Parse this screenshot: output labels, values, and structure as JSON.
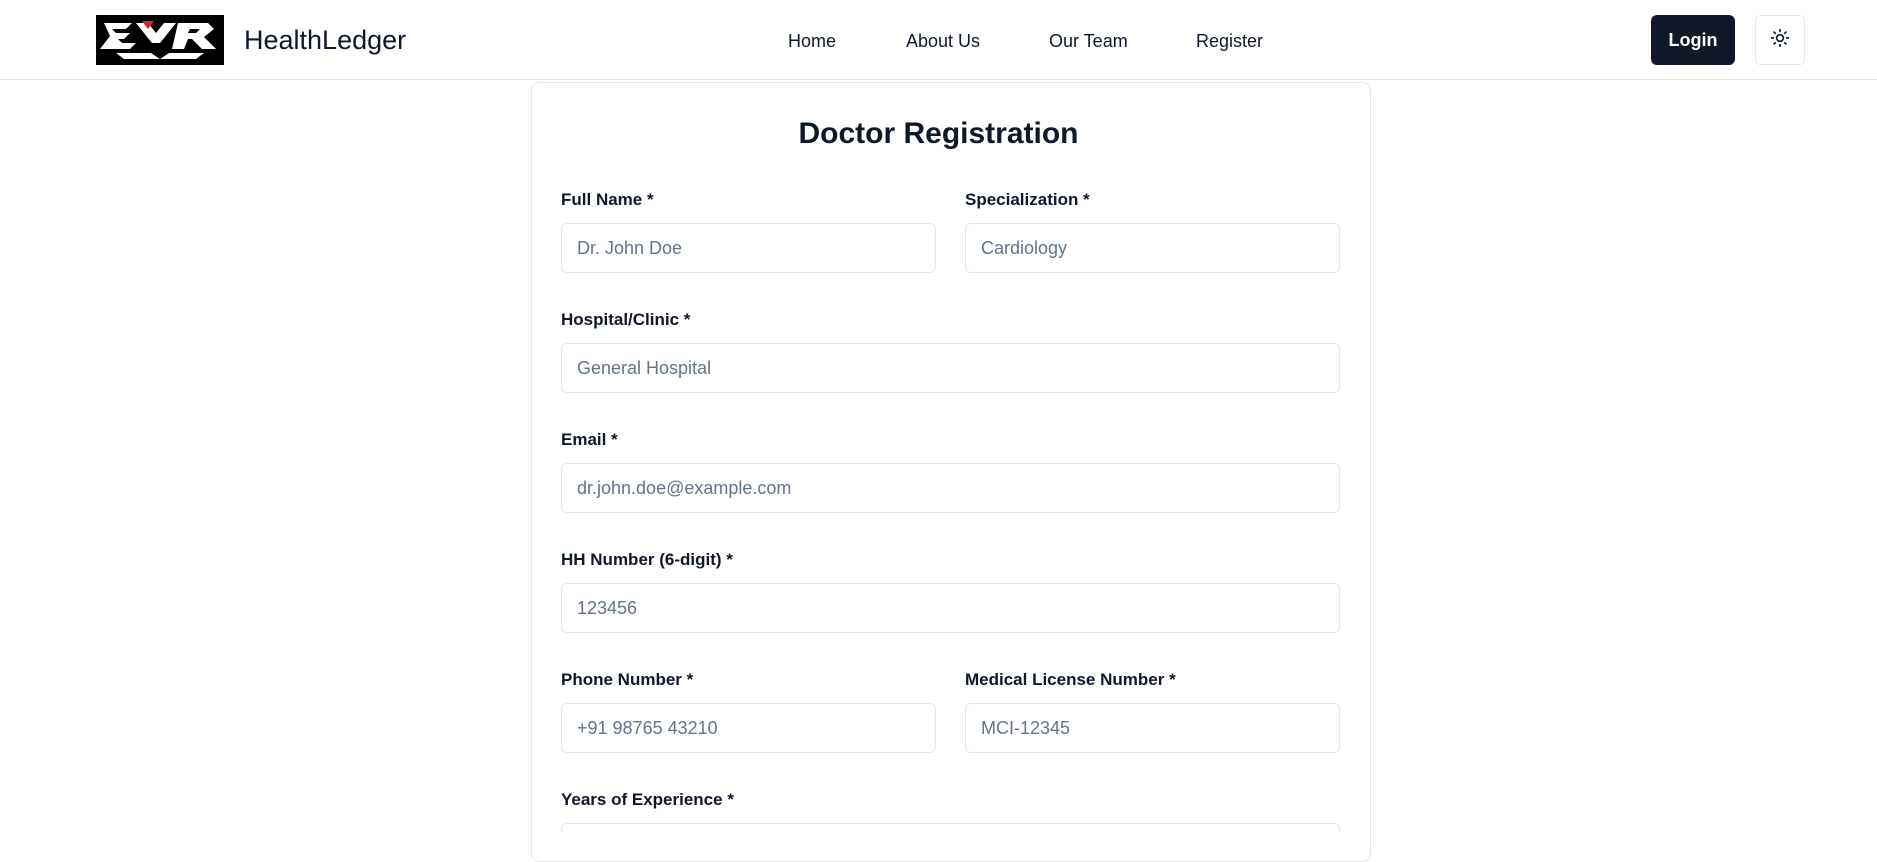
{
  "header": {
    "brand": "HealthLedger",
    "logo_icon": "ehr-logo",
    "nav": {
      "home": "Home",
      "about": "About Us",
      "team": "Our Team",
      "register": "Register"
    },
    "login_label": "Login",
    "theme_icon": "sun-icon"
  },
  "form": {
    "title": "Doctor Registration",
    "fields": {
      "full_name": {
        "label": "Full Name *",
        "placeholder": "Dr. John Doe"
      },
      "specialization": {
        "label": "Specialization *",
        "placeholder": "Cardiology"
      },
      "hospital": {
        "label": "Hospital/Clinic *",
        "placeholder": "General Hospital"
      },
      "email": {
        "label": "Email *",
        "placeholder": "dr.john.doe@example.com"
      },
      "hh_number": {
        "label": "HH Number (6-digit) *",
        "placeholder": "123456"
      },
      "phone": {
        "label": "Phone Number *",
        "placeholder": "+91 98765 43210"
      },
      "license": {
        "label": "Medical License Number *",
        "placeholder": "MCI-12345"
      },
      "experience": {
        "label": "Years of Experience *",
        "placeholder": ""
      }
    }
  },
  "colors": {
    "primary_button": "#111827",
    "border": "#e2e8f0",
    "placeholder": "#64748b"
  }
}
